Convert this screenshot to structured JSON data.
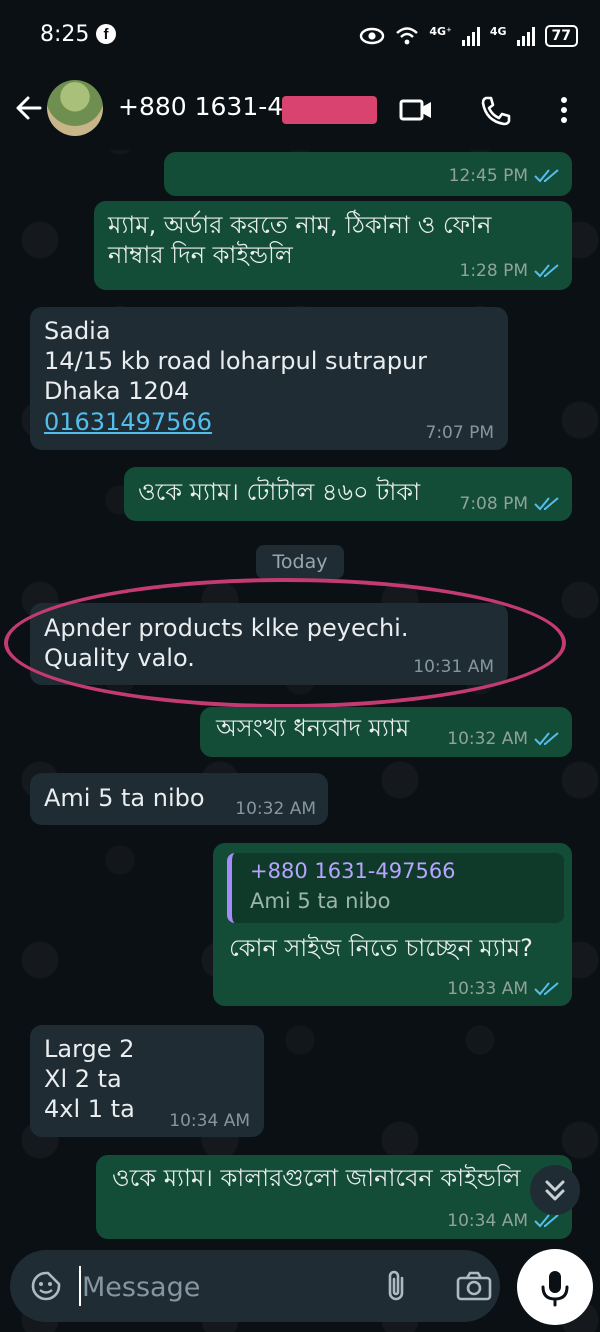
{
  "status_bar": {
    "time": "8:25",
    "network_1": "4G⁺",
    "network_2": "4G",
    "battery": "77"
  },
  "header": {
    "contact": "+880 1631-4"
  },
  "messages": [
    {
      "time": "12:45 PM"
    },
    {
      "text": "ম্যাম, অর্ডার করতে নাম, ঠিকানা ও ফোন\nনাম্বার দিন কাইন্ডলি",
      "time": "1:28 PM"
    },
    {
      "text": "Sadia\n14/15 kb road loharpul sutrapur\nDhaka 1204",
      "link": "01631497566",
      "time": "7:07 PM"
    },
    {
      "text": "ওকে ম্যাম। টোটাল ৪৬০ টাকা",
      "time": "7:08 PM"
    },
    {
      "text": "Apnder products klke peyechi.\nQuality valo.",
      "time": "10:31 AM"
    },
    {
      "text": "অসংখ্য ধন্যবাদ ম্যাম",
      "time": "10:32 AM"
    },
    {
      "text": "Ami 5 ta nibo",
      "time": "10:32 AM"
    },
    {
      "quote_name": "+880 1631-497566",
      "quote_text": "Ami 5 ta nibo",
      "text": "কোন সাইজ নিতে চাচ্ছেন ম্যাম?",
      "time": "10:33 AM"
    },
    {
      "text": "Large 2\nXl 2 ta\n4xl 1 ta",
      "time": "10:34 AM"
    },
    {
      "text": "ওকে ম্যাম। কালারগুলো জানাবেন কাইন্ডলি",
      "time": "10:34 AM"
    }
  ],
  "day_separator": "Today",
  "input": {
    "placeholder": "Message"
  }
}
